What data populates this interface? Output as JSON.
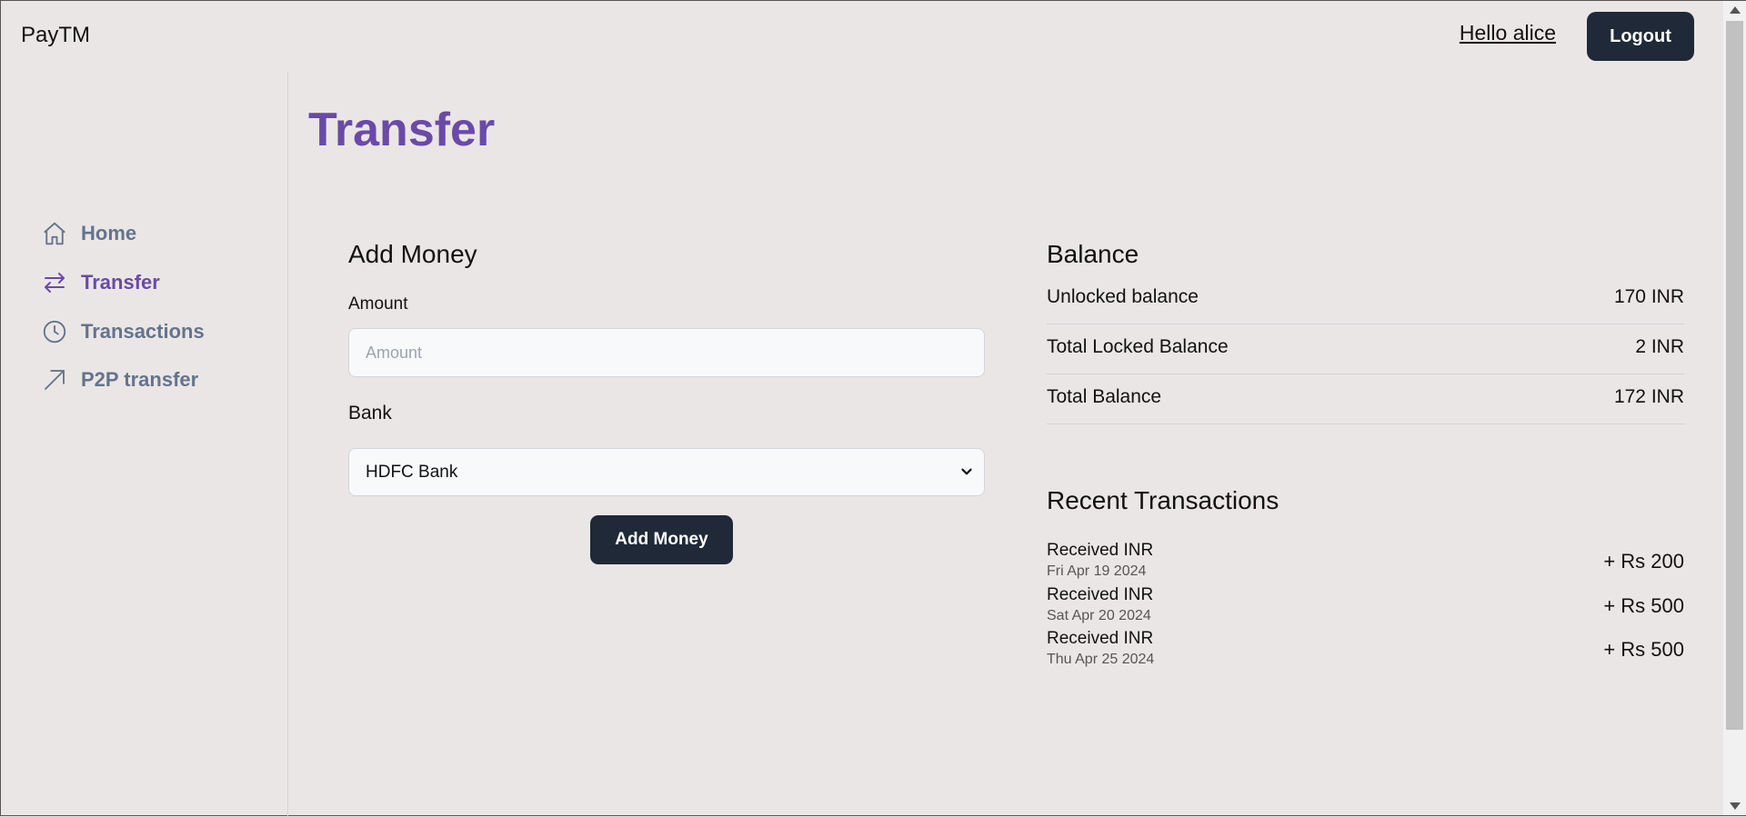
{
  "header": {
    "brand": "PayTM",
    "greeting": "Hello alice",
    "logout_label": "Logout"
  },
  "sidebar": {
    "items": [
      {
        "label": "Home",
        "icon": "home-icon",
        "active": false
      },
      {
        "label": "Transfer",
        "icon": "arrows-transfer-icon",
        "active": true
      },
      {
        "label": "Transactions",
        "icon": "clock-icon",
        "active": false
      },
      {
        "label": "P2P transfer",
        "icon": "arrow-up-right-icon",
        "active": false
      }
    ]
  },
  "main": {
    "title": "Transfer",
    "add_money": {
      "title": "Add Money",
      "amount_label": "Amount",
      "amount_placeholder": "Amount",
      "amount_value": "",
      "bank_label": "Bank",
      "bank_selected": "HDFC Bank",
      "submit_label": "Add Money"
    },
    "balance": {
      "title": "Balance",
      "rows": [
        {
          "label": "Unlocked balance",
          "value": "170 INR"
        },
        {
          "label": "Total Locked Balance",
          "value": "2 INR"
        },
        {
          "label": "Total Balance",
          "value": "172 INR"
        }
      ]
    },
    "recent": {
      "title": "Recent Transactions",
      "items": [
        {
          "desc": "Received INR",
          "date": "Fri Apr 19 2024",
          "amount": "+ Rs 200"
        },
        {
          "desc": "Received INR",
          "date": "Sat Apr 20 2024",
          "amount": "+ Rs 500"
        },
        {
          "desc": "Received INR",
          "date": "Thu Apr 25 2024",
          "amount": "+ Rs 500"
        }
      ]
    }
  },
  "colors": {
    "accent": "#6a4aa8",
    "button_dark": "#1f2937",
    "muted_nav": "#64748b",
    "background": "#ebe6e6"
  }
}
